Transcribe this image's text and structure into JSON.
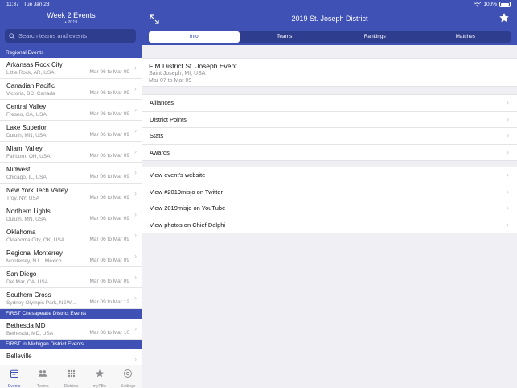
{
  "status": {
    "time": "11:37",
    "date": "Tue Jan 28",
    "battery": "100%"
  },
  "left": {
    "title": "Week 2 Events",
    "subtitle": "• 2019",
    "search_placeholder": "Search teams and events",
    "sections": [
      {
        "header": "Regional Events",
        "events": [
          {
            "name": "Arkansas Rock City",
            "location": "Little Rock, AR, USA",
            "dates": "Mar 06 to Mar 09"
          },
          {
            "name": "Canadian Pacific",
            "location": "Victoria, BC, Canada",
            "dates": "Mar 06 to Mar 09"
          },
          {
            "name": "Central Valley",
            "location": "Fresno, CA, USA",
            "dates": "Mar 06 to Mar 09"
          },
          {
            "name": "Lake Superior",
            "location": "Duluth, MN, USA",
            "dates": "Mar 06 to Mar 09"
          },
          {
            "name": "Miami Valley",
            "location": "Fairborn, OH, USA",
            "dates": "Mar 06 to Mar 09"
          },
          {
            "name": "Midwest",
            "location": "Chicago, IL, USA",
            "dates": "Mar 06 to Mar 09"
          },
          {
            "name": "New York Tech Valley",
            "location": "Troy, NY, USA",
            "dates": "Mar 06 to Mar 09"
          },
          {
            "name": "Northern Lights",
            "location": "Duluth, MN, USA",
            "dates": "Mar 06 to Mar 09"
          },
          {
            "name": "Oklahoma",
            "location": "Oklahoma City, OK, USA",
            "dates": "Mar 06 to Mar 09"
          },
          {
            "name": "Regional Monterrey",
            "location": "Monterrey, N.L., Mexico",
            "dates": "Mar 06 to Mar 09"
          },
          {
            "name": "San Diego",
            "location": "Del Mar, CA, USA",
            "dates": "Mar 06 to Mar 09"
          },
          {
            "name": "Southern Cross",
            "location": "Sydney Olympic Park, NSW,...",
            "dates": "Mar 09 to Mar 12"
          }
        ]
      },
      {
        "header": "FIRST Chesapeake District Events",
        "events": [
          {
            "name": "Bethesda MD",
            "location": "Bethesda, MD, USA",
            "dates": "Mar 08 to Mar 10"
          }
        ]
      },
      {
        "header": "FIRST In Michigan District Events",
        "events": [
          {
            "name": "Belleville",
            "location": "",
            "dates": ""
          }
        ]
      }
    ],
    "tabs": [
      {
        "label": "Events",
        "icon": "events-icon",
        "active": true
      },
      {
        "label": "Teams",
        "icon": "teams-icon",
        "active": false
      },
      {
        "label": "Districts",
        "icon": "districts-icon",
        "active": false
      },
      {
        "label": "myTBA",
        "icon": "star-icon",
        "active": false
      },
      {
        "label": "Settings",
        "icon": "settings-icon",
        "active": false
      }
    ]
  },
  "right": {
    "title": "2019 St. Joseph District",
    "segments": [
      {
        "label": "Info",
        "active": true
      },
      {
        "label": "Teams",
        "active": false
      },
      {
        "label": "Rankings",
        "active": false
      },
      {
        "label": "Matches",
        "active": false
      }
    ],
    "event": {
      "name": "FIM District St. Joseph Event",
      "location": "Saint Joseph, MI, USA",
      "dates": "Mar 07 to Mar 09"
    },
    "group1": [
      "Alliances",
      "District Points",
      "Stats",
      "Awards"
    ],
    "group2": [
      "View event's website",
      "View #2019misjo on Twitter",
      "View 2019misjo on YouTube",
      "View photos on Chief Delphi"
    ]
  },
  "colors": {
    "primary": "#3f51b5",
    "primary_dark": "#2f3d8f",
    "background": "#efeff4"
  }
}
